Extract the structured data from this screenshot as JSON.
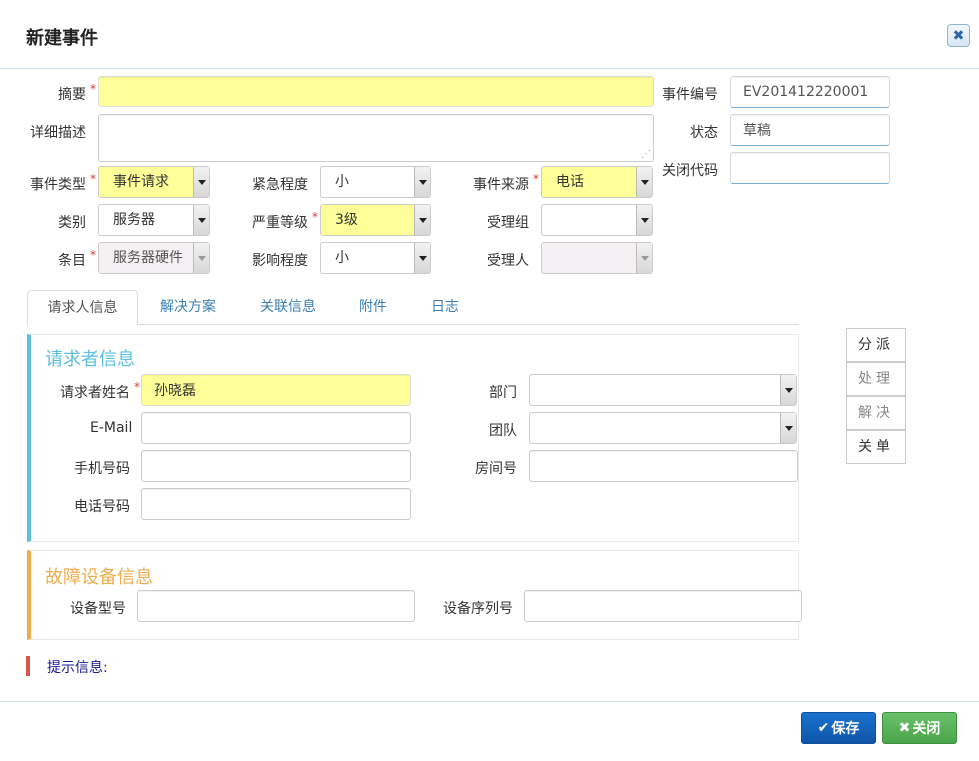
{
  "dialog": {
    "title": "新建事件",
    "close_glyph": "✖"
  },
  "form": {
    "summary": {
      "label": "摘要",
      "value": ""
    },
    "description": {
      "label": "详细描述",
      "value": ""
    },
    "event_no": {
      "label": "事件编号",
      "value": "EV201412220001"
    },
    "status": {
      "label": "状态",
      "value": "草稿"
    },
    "close_code": {
      "label": "关闭代码",
      "value": ""
    },
    "event_type": {
      "label": "事件类型",
      "value": "事件请求"
    },
    "urgency": {
      "label": "紧急程度",
      "value": "小"
    },
    "source": {
      "label": "事件来源",
      "value": "电话"
    },
    "category": {
      "label": "类别",
      "value": "服务器"
    },
    "severity": {
      "label": "严重等级",
      "value": "3级"
    },
    "group": {
      "label": "受理组",
      "value": ""
    },
    "item": {
      "label": "条目",
      "value": "服务器硬件"
    },
    "impact": {
      "label": "影响程度",
      "value": "小"
    },
    "assignee": {
      "label": "受理人",
      "value": ""
    }
  },
  "tabs": [
    {
      "label": "请求人信息"
    },
    {
      "label": "解决方案"
    },
    {
      "label": "关联信息"
    },
    {
      "label": "附件"
    },
    {
      "label": "日志"
    }
  ],
  "requester": {
    "title": "请求者信息",
    "name": {
      "label": "请求者姓名",
      "value": "孙晓磊"
    },
    "email": {
      "label": "E-Mail",
      "value": ""
    },
    "mobile": {
      "label": "手机号码",
      "value": ""
    },
    "phone": {
      "label": "电话号码",
      "value": ""
    },
    "dept": {
      "label": "部门",
      "value": ""
    },
    "team": {
      "label": "团队",
      "value": ""
    },
    "room": {
      "label": "房间号",
      "value": ""
    }
  },
  "device": {
    "title": "故障设备信息",
    "model": {
      "label": "设备型号",
      "value": ""
    },
    "serial": {
      "label": "设备序列号",
      "value": ""
    }
  },
  "side_actions": [
    "分派",
    "处理",
    "解决",
    "关单"
  ],
  "hint": "提示信息:",
  "footer": {
    "save": "保存",
    "close": "关闭",
    "save_icon": "✔",
    "close_icon": "✖"
  }
}
